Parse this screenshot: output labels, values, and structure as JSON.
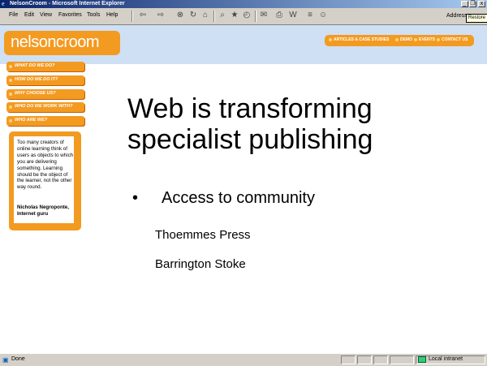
{
  "window": {
    "title": "NelsonCroom - Microsoft Internet Explorer",
    "minimize": "_",
    "restore": "❒",
    "close": "x"
  },
  "menu": {
    "file": "File",
    "edit": "Edit",
    "view": "View",
    "favorites": "Favorites",
    "tools": "Tools",
    "help": "Help"
  },
  "toolbar": {
    "back_icon": "⇦",
    "forward_icon": "⇨",
    "stop_icon": "⊗",
    "refresh_icon": "↻",
    "home_icon": "⌂",
    "search_icon": "⌕",
    "favorites_icon": "★",
    "history_icon": "◴",
    "mail_icon": "✉",
    "print_icon": "⎙",
    "edit_icon": "W",
    "discuss_icon": "≡",
    "messenger_icon": "☺",
    "address_label": "Address",
    "tooltip": "Restore"
  },
  "site": {
    "logo": "nelsoncroom",
    "top_nav": [
      "ARTICLES & CASE STUDIES",
      "DEMO",
      "EVENTS",
      "CONTACT US"
    ],
    "side_nav": [
      "WHAT DO WE DO?",
      "HOW DO WE DO IT?",
      "WHY CHOOSE US?",
      "WHO DO WE WORK WITH?",
      "WHO ARE WE?"
    ],
    "quote_text": "Too many creators of online learning think of users as objects to which you are delivering something. Learning should be the object of the learner, not the other way round.",
    "quote_author": "Nicholas Negroponte, Internet guru"
  },
  "slide": {
    "title": "Web is transforming specialist publishing",
    "bullet_char": "•",
    "bullet": "Access to community",
    "sub_items": [
      "Thoemmes Press",
      "Barrington Stoke"
    ]
  },
  "status": {
    "text": "Done",
    "zone": "Local intranet"
  }
}
